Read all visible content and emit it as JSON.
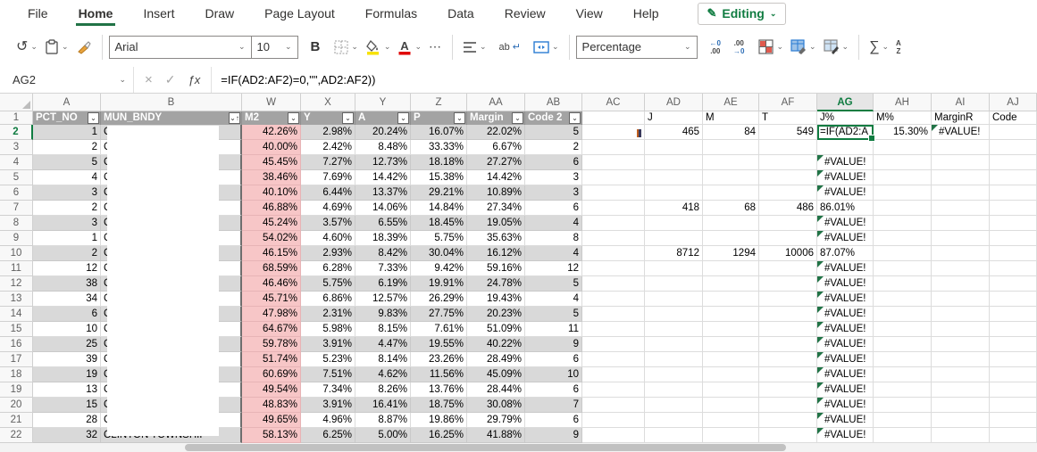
{
  "menu": {
    "tabs": [
      {
        "label": "File",
        "active": false
      },
      {
        "label": "Home",
        "active": true
      },
      {
        "label": "Insert",
        "active": false
      },
      {
        "label": "Draw",
        "active": false
      },
      {
        "label": "Page Layout",
        "active": false
      },
      {
        "label": "Formulas",
        "active": false
      },
      {
        "label": "Data",
        "active": false
      },
      {
        "label": "Review",
        "active": false
      },
      {
        "label": "View",
        "active": false
      },
      {
        "label": "Help",
        "active": false
      }
    ],
    "editing_label": "Editing",
    "pencil_icon": "✎",
    "chevron": "⌄"
  },
  "toolbar": {
    "undo_icon": "↺",
    "font_name": "Arial",
    "font_size": "10",
    "bold_label": "B",
    "more_label": "⋯",
    "wrap_label": "ab",
    "wrap_arrow": "↵",
    "number_format": "Percentage",
    "decrease_decimal_top": "←0",
    "decrease_decimal_bottom": ".00",
    "increase_decimal_top": ".00",
    "increase_decimal_bottom": "→0",
    "sum_label": "∑",
    "sort_top": "A",
    "sort_bottom": "Z"
  },
  "formula_bar": {
    "name_box": "AG2",
    "cancel_icon": "×",
    "confirm_icon": "✓",
    "fx_label": "ƒx",
    "formula": "=IF(AD2:AF2)=0,\"\",AD2:AF2))"
  },
  "colors": {
    "accent_green": "#107c41",
    "band_gray": "#d9d9d9",
    "w_column_pink": "#f7c6c7",
    "filter_header_gray": "#a3a3a3"
  },
  "grid": {
    "columns": [
      "A",
      "B",
      "W",
      "X",
      "Y",
      "Z",
      "AA",
      "AB",
      "AC",
      "AD",
      "AE",
      "AF",
      "AG",
      "AH",
      "AI",
      "AJ"
    ],
    "filter_headers": {
      "A": "PCT_NO",
      "B": "MUN_BNDY",
      "W": "M2",
      "X": "Y",
      "Y": "A",
      "Z": "P",
      "AA": "Margin",
      "AB": "Code 2"
    },
    "plain_headers": {
      "AD": "J",
      "AE": "M",
      "AF": "T",
      "AG": "J%",
      "AH": "M%",
      "AI": "MarginR",
      "AJ": "Code"
    },
    "sorted_filter_column": "B",
    "filter_chevron": "⌄",
    "sort_arrow": "↑",
    "stray_marker_cell": "AC2",
    "selection": {
      "cell": "AG2",
      "column": "AG",
      "row": 2,
      "edit_text": "=IF(AD2:A"
    },
    "rows": [
      {
        "n": 2,
        "A": "1",
        "B": "C",
        "W": "42.26%",
        "X": "2.98%",
        "Y": "20.24%",
        "Z": "16.07%",
        "AA": "22.02%",
        "AB": "5",
        "AD": "465",
        "AE": "84",
        "AF": "549",
        "AG": "=IF(AD2:A",
        "AH": "15.30%",
        "AI": "#VALUE!"
      },
      {
        "n": 3,
        "A": "2",
        "B": "C",
        "W": "40.00%",
        "X": "2.42%",
        "Y": "8.48%",
        "Z": "33.33%",
        "AA": "6.67%",
        "AB": "2"
      },
      {
        "n": 4,
        "A": "5",
        "B": "C",
        "W": "45.45%",
        "X": "7.27%",
        "Y": "12.73%",
        "Z": "18.18%",
        "AA": "27.27%",
        "AB": "6",
        "AG": "#VALUE!"
      },
      {
        "n": 5,
        "A": "4",
        "B": "C",
        "W": "38.46%",
        "X": "7.69%",
        "Y": "14.42%",
        "Z": "15.38%",
        "AA": "14.42%",
        "AB": "3",
        "AG": "#VALUE!"
      },
      {
        "n": 6,
        "A": "3",
        "B": "C",
        "W": "40.10%",
        "X": "6.44%",
        "Y": "13.37%",
        "Z": "29.21%",
        "AA": "10.89%",
        "AB": "3",
        "AG": "#VALUE!"
      },
      {
        "n": 7,
        "A": "2",
        "B": "C",
        "W": "46.88%",
        "X": "4.69%",
        "Y": "14.06%",
        "Z": "14.84%",
        "AA": "27.34%",
        "AB": "6",
        "AD": "418",
        "AE": "68",
        "AF": "486",
        "AG": "86.01%"
      },
      {
        "n": 8,
        "A": "3",
        "B": "C",
        "W": "45.24%",
        "X": "3.57%",
        "Y": "6.55%",
        "Z": "18.45%",
        "AA": "19.05%",
        "AB": "4",
        "AG": "#VALUE!"
      },
      {
        "n": 9,
        "A": "1",
        "B": "C",
        "W": "54.02%",
        "X": "4.60%",
        "Y": "18.39%",
        "Z": "5.75%",
        "AA": "35.63%",
        "AB": "8",
        "AG": "#VALUE!"
      },
      {
        "n": 10,
        "A": "2",
        "B": "C",
        "W": "46.15%",
        "X": "2.93%",
        "Y": "8.42%",
        "Z": "30.04%",
        "AA": "16.12%",
        "AB": "4",
        "AD": "8712",
        "AE": "1294",
        "AF": "10006",
        "AG": "87.07%"
      },
      {
        "n": 11,
        "A": "12",
        "B": "C",
        "W": "68.59%",
        "X": "6.28%",
        "Y": "7.33%",
        "Z": "9.42%",
        "AA": "59.16%",
        "AB": "12",
        "AG": "#VALUE!"
      },
      {
        "n": 12,
        "A": "38",
        "B": "C",
        "W": "46.46%",
        "X": "5.75%",
        "Y": "6.19%",
        "Z": "19.91%",
        "AA": "24.78%",
        "AB": "5",
        "AG": "#VALUE!"
      },
      {
        "n": 13,
        "A": "34",
        "B": "C",
        "W": "45.71%",
        "X": "6.86%",
        "Y": "12.57%",
        "Z": "26.29%",
        "AA": "19.43%",
        "AB": "4",
        "AG": "#VALUE!"
      },
      {
        "n": 14,
        "A": "6",
        "B": "C",
        "W": "47.98%",
        "X": "2.31%",
        "Y": "9.83%",
        "Z": "27.75%",
        "AA": "20.23%",
        "AB": "5",
        "AG": "#VALUE!"
      },
      {
        "n": 15,
        "A": "10",
        "B": "C",
        "W": "64.67%",
        "X": "5.98%",
        "Y": "8.15%",
        "Z": "7.61%",
        "AA": "51.09%",
        "AB": "11",
        "AG": "#VALUE!"
      },
      {
        "n": 16,
        "A": "25",
        "B": "C",
        "W": "59.78%",
        "X": "3.91%",
        "Y": "4.47%",
        "Z": "19.55%",
        "AA": "40.22%",
        "AB": "9",
        "AG": "#VALUE!"
      },
      {
        "n": 17,
        "A": "39",
        "B": "C",
        "W": "51.74%",
        "X": "5.23%",
        "Y": "8.14%",
        "Z": "23.26%",
        "AA": "28.49%",
        "AB": "6",
        "AG": "#VALUE!"
      },
      {
        "n": 18,
        "A": "19",
        "B": "C",
        "W": "60.69%",
        "X": "7.51%",
        "Y": "4.62%",
        "Z": "11.56%",
        "AA": "45.09%",
        "AB": "10",
        "AG": "#VALUE!"
      },
      {
        "n": 19,
        "A": "13",
        "B": "C",
        "W": "49.54%",
        "X": "7.34%",
        "Y": "8.26%",
        "Z": "13.76%",
        "AA": "28.44%",
        "AB": "6",
        "AG": "#VALUE!"
      },
      {
        "n": 20,
        "A": "15",
        "B": "C",
        "W": "48.83%",
        "X": "3.91%",
        "Y": "16.41%",
        "Z": "18.75%",
        "AA": "30.08%",
        "AB": "7",
        "AG": "#VALUE!"
      },
      {
        "n": 21,
        "A": "28",
        "B": "C",
        "W": "49.65%",
        "X": "4.96%",
        "Y": "8.87%",
        "Z": "19.86%",
        "AA": "29.79%",
        "AB": "6",
        "AG": "#VALUE!"
      },
      {
        "n": 22,
        "A": "32",
        "B": "CLINTON TOWNSHIP",
        "W": "58.13%",
        "X": "6.25%",
        "Y": "5.00%",
        "Z": "16.25%",
        "AA": "41.88%",
        "AB": "9",
        "AG": "#VALUE!"
      }
    ]
  }
}
